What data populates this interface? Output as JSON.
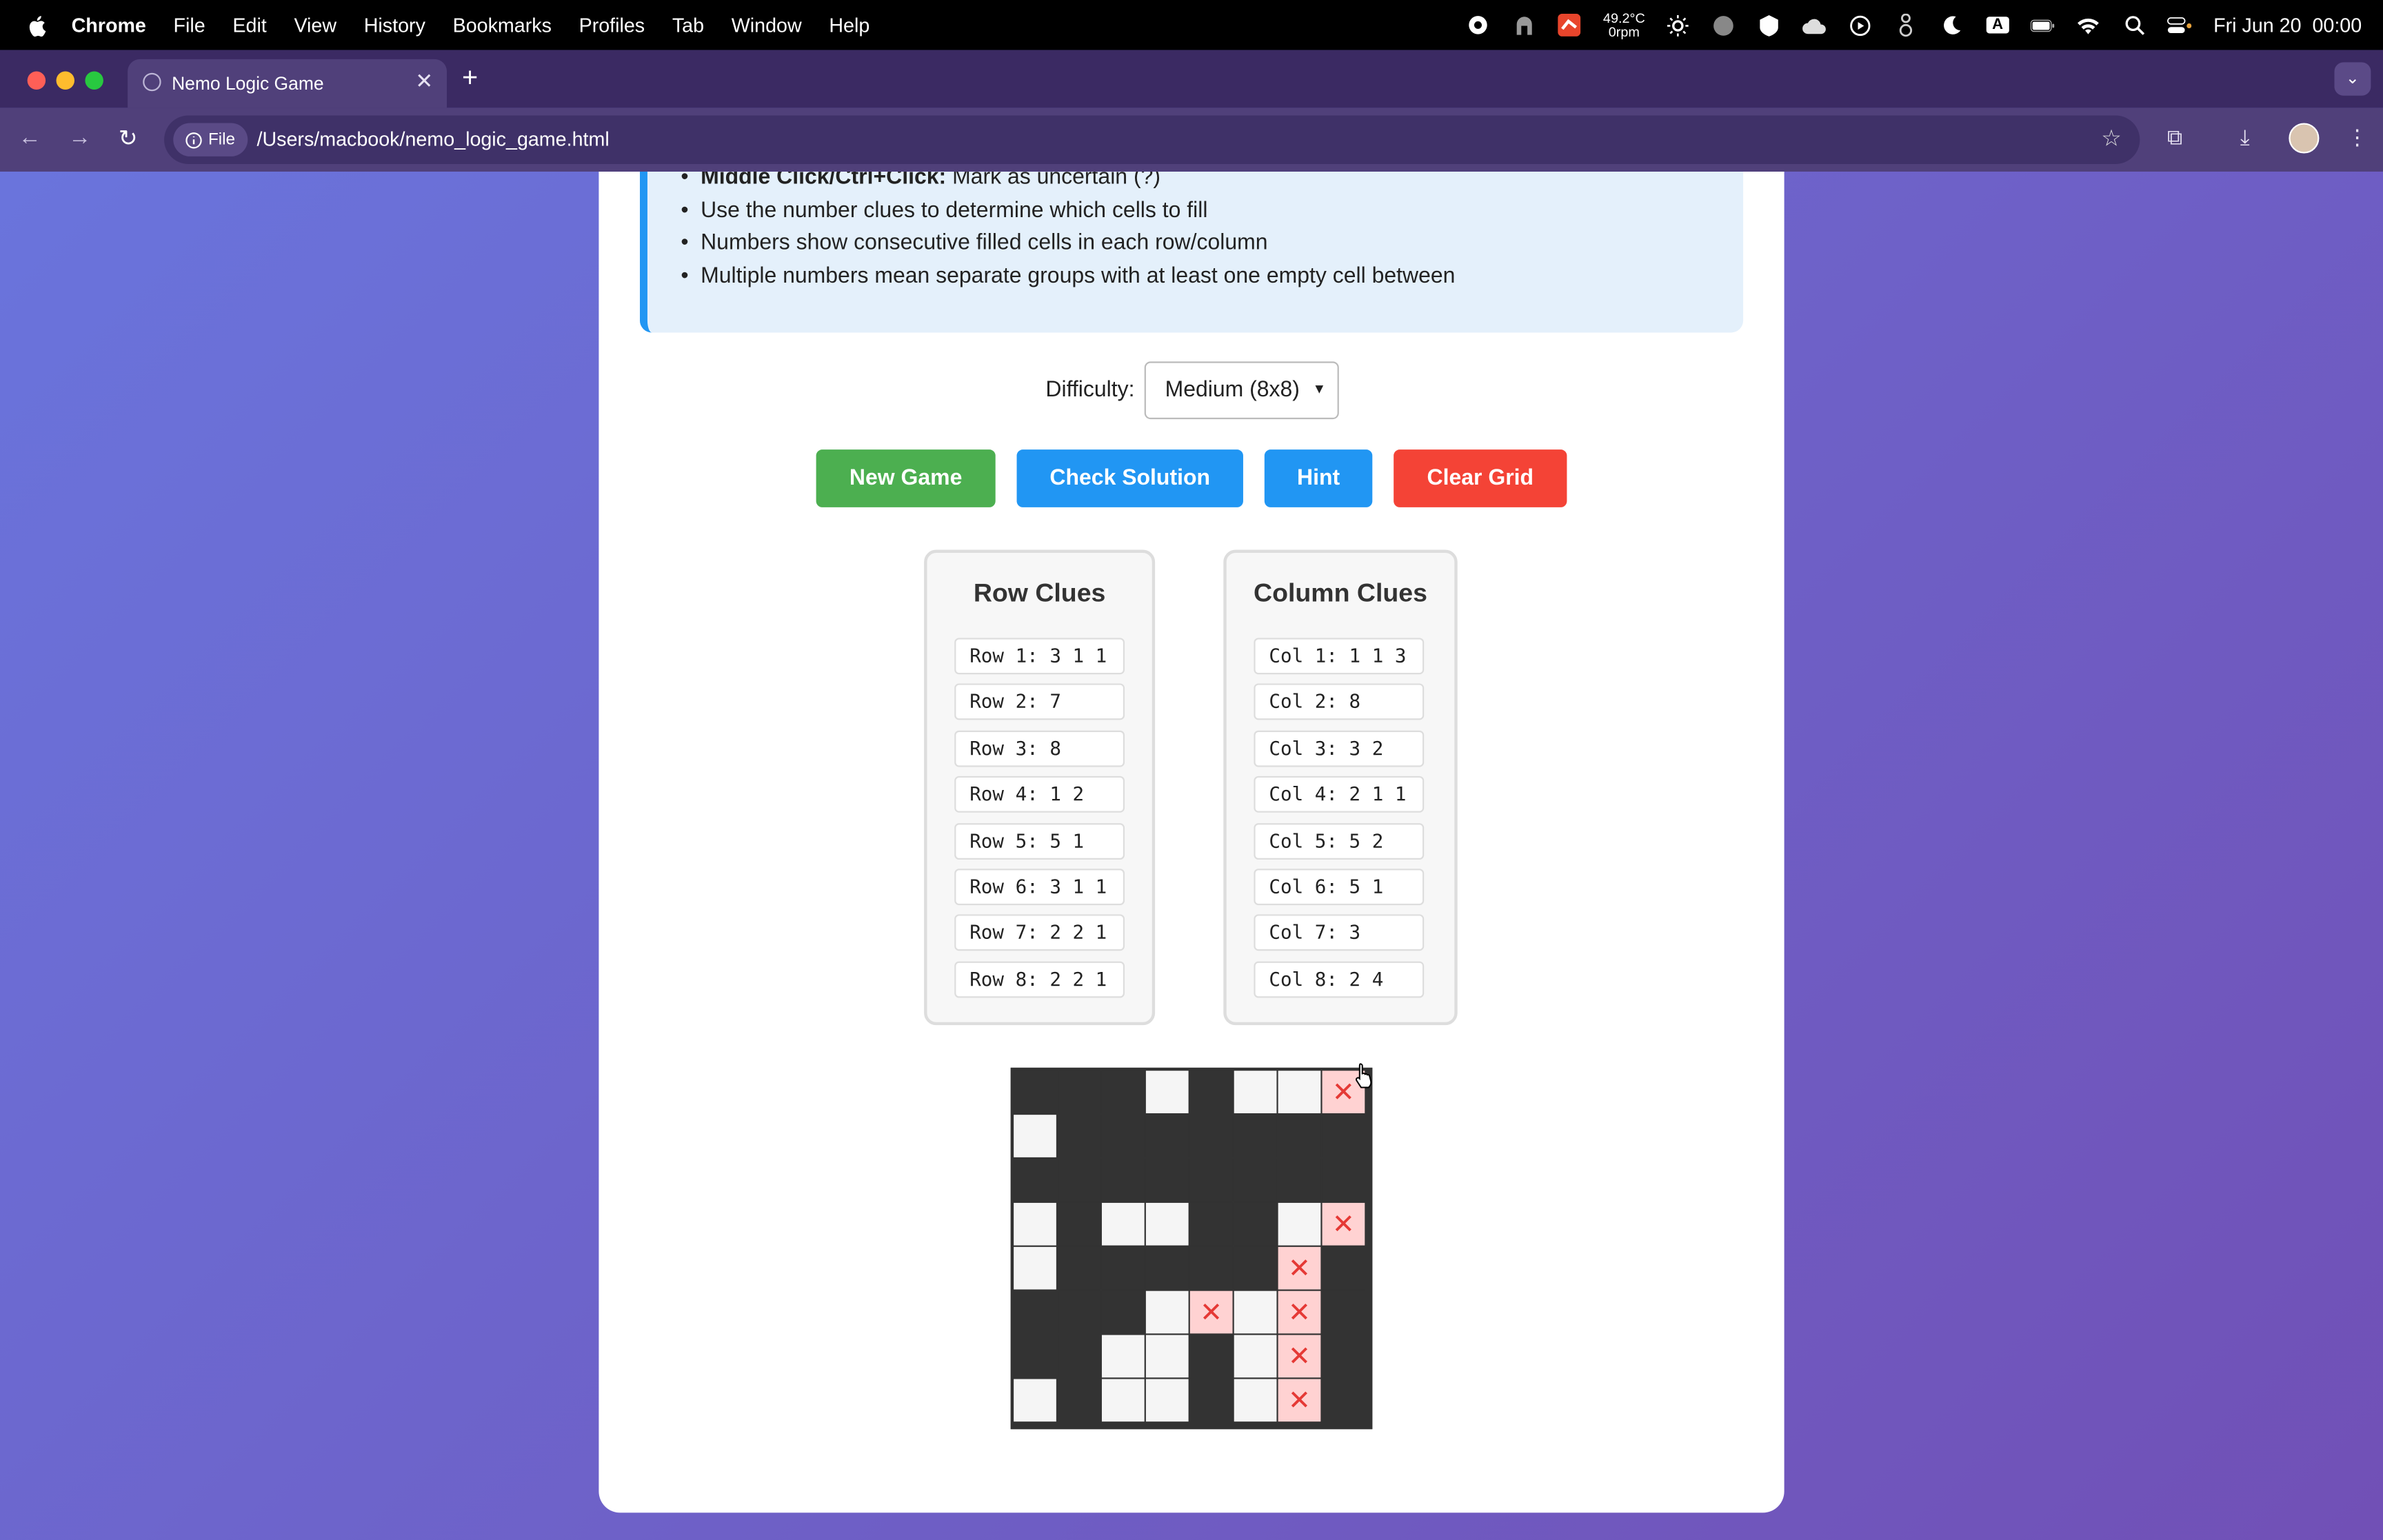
{
  "menubar": {
    "app_name": "Chrome",
    "menus": [
      "File",
      "Edit",
      "View",
      "History",
      "Bookmarks",
      "Profiles",
      "Tab",
      "Window",
      "Help"
    ],
    "weather_temp": "49.2°C",
    "weather_fan": "0rpm",
    "input_indicator": "A",
    "datetime": "Fri Jun 20  00:00"
  },
  "browser": {
    "tab_title": "Nemo Logic Game",
    "url_chip": "File",
    "url": "/Users/macbook/nemo_logic_game.html"
  },
  "instructions": {
    "items": [
      {
        "bold": "Middle Click/Ctrl+Click:",
        "text": " Mark as uncertain (?)"
      },
      {
        "bold": "",
        "text": "Use the number clues to determine which cells to fill"
      },
      {
        "bold": "",
        "text": "Numbers show consecutive filled cells in each row/column"
      },
      {
        "bold": "",
        "text": "Multiple numbers mean separate groups with at least one empty cell between"
      }
    ]
  },
  "controls": {
    "difficulty_label": "Difficulty:",
    "difficulty_value": "Medium (8x8)",
    "buttons": {
      "new_game": "New Game",
      "check_solution": "Check Solution",
      "hint": "Hint",
      "clear_grid": "Clear Grid"
    },
    "colors": {
      "new_game": "#4caf50",
      "check_solution": "#2196f3",
      "hint": "#2196f3",
      "clear_grid": "#f44336"
    }
  },
  "row_clues": {
    "title": "Row Clues",
    "items": [
      "Row 1: 3 1 1",
      "Row 2: 7",
      "Row 3: 8",
      "Row 4: 1 2",
      "Row 5: 5 1",
      "Row 6: 3 1 1",
      "Row 7: 2 2 1",
      "Row 8: 2 2 1"
    ]
  },
  "column_clues": {
    "title": "Column Clues",
    "items": [
      "Col 1: 1 1 3",
      "Col 2: 8",
      "Col 3: 3 2",
      "Col 4: 2 1 1",
      "Col 5: 5 2",
      "Col 6: 5 1",
      "Col 7: 3",
      "Col 8: 2 4"
    ]
  },
  "grid": {
    "legend": {
      "F": "filled",
      "E": "empty",
      "X": "crossed"
    },
    "cross_glyph": "✕",
    "rows": [
      "FFFEFEEX",
      "EFFFFFFF",
      "FFFFFFFF",
      "EFEEFFEX",
      "EFFFFFXF",
      "FFFEXEXF",
      "FFEEFEXF",
      "EFEEFEXF"
    ]
  }
}
